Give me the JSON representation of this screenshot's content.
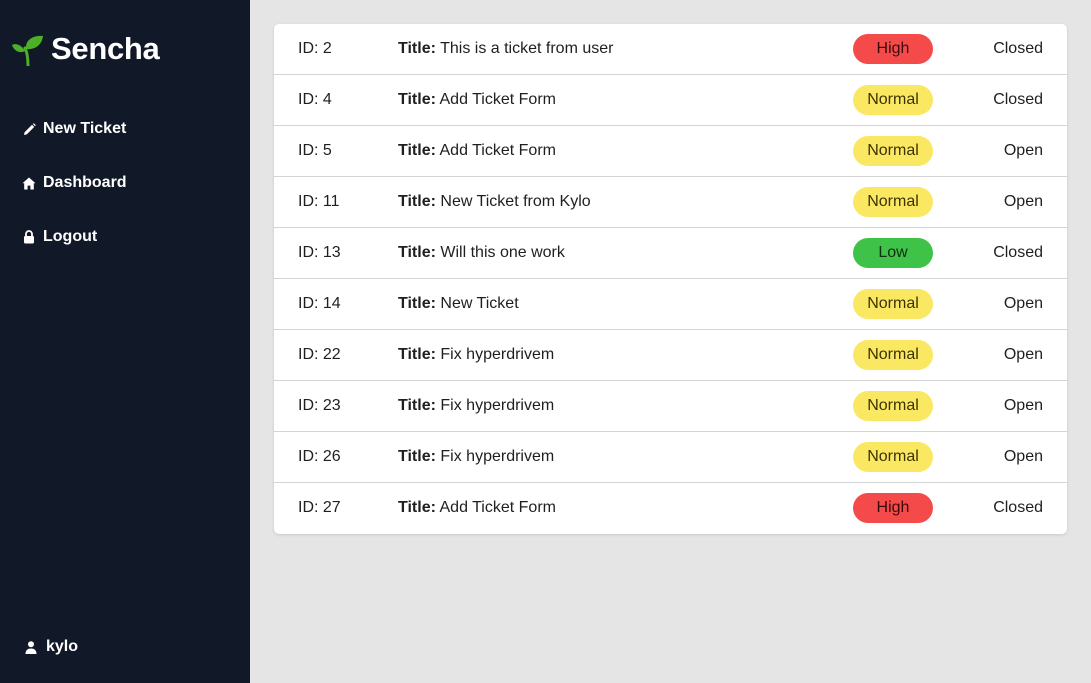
{
  "brand": {
    "name": "Sencha",
    "logo_icon": "sprout-icon",
    "logo_color": "#4caf28"
  },
  "nav": {
    "new_ticket": "New Ticket",
    "dashboard": "Dashboard",
    "logout": "Logout"
  },
  "user": {
    "name": "kylo"
  },
  "labels": {
    "id_prefix": "ID: ",
    "title_label": "Title:"
  },
  "colors": {
    "sidebar_bg": "#111827",
    "page_bg": "#e5e5e5",
    "priority_high": "#f54a4a",
    "priority_normal": "#fbe862",
    "priority_low": "#3fc248"
  },
  "tickets": [
    {
      "id": "ID: 2",
      "title": "This is a ticket from user",
      "priority": "High",
      "priority_level": "high",
      "status": "Closed"
    },
    {
      "id": "ID: 4",
      "title": "Add Ticket Form",
      "priority": "Normal",
      "priority_level": "normal",
      "status": "Closed"
    },
    {
      "id": "ID: 5",
      "title": "Add Ticket Form",
      "priority": "Normal",
      "priority_level": "normal",
      "status": "Open"
    },
    {
      "id": "ID: 11",
      "title": "New Ticket from Kylo",
      "priority": "Normal",
      "priority_level": "normal",
      "status": "Open"
    },
    {
      "id": "ID: 13",
      "title": "Will this one work",
      "priority": "Low",
      "priority_level": "low",
      "status": "Closed"
    },
    {
      "id": "ID: 14",
      "title": "New Ticket",
      "priority": "Normal",
      "priority_level": "normal",
      "status": "Open"
    },
    {
      "id": "ID: 22",
      "title": "Fix hyperdrivem",
      "priority": "Normal",
      "priority_level": "normal",
      "status": "Open"
    },
    {
      "id": "ID: 23",
      "title": "Fix hyperdrivem",
      "priority": "Normal",
      "priority_level": "normal",
      "status": "Open"
    },
    {
      "id": "ID: 26",
      "title": "Fix hyperdrivem",
      "priority": "Normal",
      "priority_level": "normal",
      "status": "Open"
    },
    {
      "id": "ID: 27",
      "title": "Add Ticket Form",
      "priority": "High",
      "priority_level": "high",
      "status": "Closed"
    }
  ]
}
